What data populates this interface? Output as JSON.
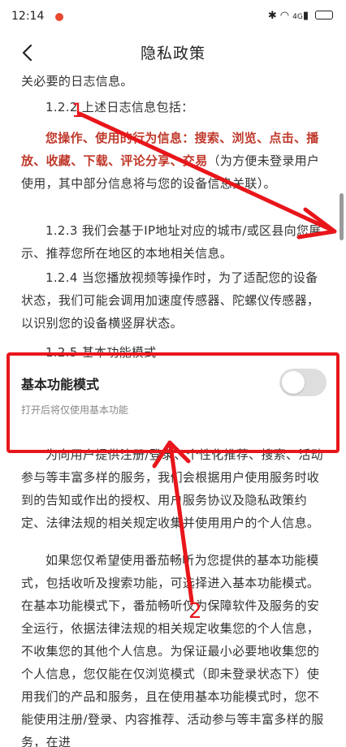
{
  "status_bar": {
    "time": "12:14",
    "icons": [
      "bluetooth-icon",
      "wifi-icon",
      "signal-icon",
      "battery-icon"
    ],
    "signal_text": "4G"
  },
  "nav": {
    "title": "隐私政策"
  },
  "content": {
    "top_fragment": "关必要的日志信息。",
    "section_121": "1.2.2 上述日志信息包括：",
    "detail_red": "您操作、使用的行为信息：搜索、浏览、点击、播放、收藏、下载、评论分享、交易",
    "detail_rest": "（为方便未登录用户使用，其中部分信息将与您的设备信息关联）。",
    "section_123": "1.2.3 我们会基于IP地址对应的城市/或区县向您展示、推荐您所在地区的本地相关信息。",
    "section_124": "1.2.4 当您播放视频等操作时，为了适配您的设备状态，我们可能会调用加速度传感器、陀螺仪传感器，以识别您的设备横竖屏状态。",
    "section_125": "1.2.5 基本功能模式",
    "toggle_label": "基本功能模式",
    "toggle_state": "off",
    "toggle_desc": "打开后将仅使用基本功能",
    "para_after1": "为向用户提供注册/登录、个性化推荐、搜索、活动参与等丰富多样的服务，我们会根据用户使用服务时收到的告知或作出的授权、用户服务协议及隐私政策约定、法律法规的相关规定收集并使用用户的个人信息。",
    "para_after2": "如果您仅希望使用番茄畅听为您提供的基本功能模式，包括收听及搜索功能，可选择进入基本功能模式。在基本功能模式下，番茄畅听仅为保障软件及服务的安全运行，依据法律法规的相关规定收集您的个人信息，不收集您的其他个人信息。为保证最小必要地收集您的个人信息，您仅能在仅浏览模式（即未登录状态下）使用我们的产品和服务，且在使用基本功能模式时，您不能使用注册/登录、内容推荐、活动参与等丰富多样的服务，在进"
  },
  "annotations": {
    "mark_1": "1",
    "mark_2": "2",
    "color": "#e8161b"
  },
  "colors": {
    "highlight_red": "#c0392b",
    "toggle_track": "#dedede"
  }
}
